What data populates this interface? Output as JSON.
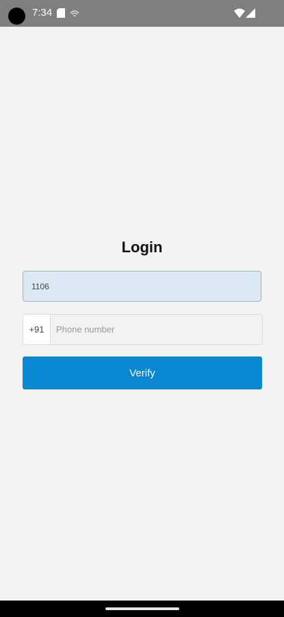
{
  "status_bar": {
    "time": "7:34",
    "icons": [
      "camera-cutout",
      "sd-card-icon",
      "sync-icon",
      "wifi-icon",
      "cell-signal-icon"
    ]
  },
  "login": {
    "title": "Login",
    "code_value": "1106",
    "country_code": "+91",
    "phone_placeholder": "Phone number",
    "phone_value": "",
    "verify_label": "Verify"
  },
  "colors": {
    "status_bar_bg": "#7f7f7f",
    "page_bg": "#f2f2f2",
    "code_input_bg": "#dce8f3",
    "code_input_border": "#8fb1d8",
    "verify_button_bg": "#0a87d1",
    "nav_bar_bg": "#000000"
  }
}
